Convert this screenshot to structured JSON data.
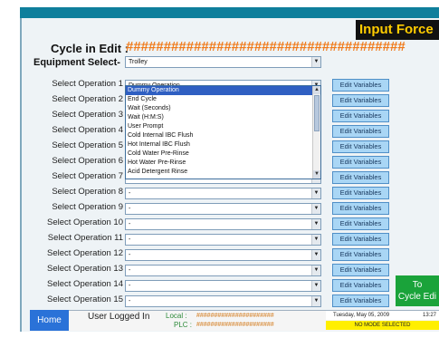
{
  "header": {
    "title": "Input Force",
    "cycle_label": "Cycle in Edit :",
    "cycle_value": "#####################################",
    "equipment_label": "Equipment Select-",
    "equipment_value": "Trolley"
  },
  "operations": [
    {
      "label": "Select Operation 1",
      "value": "Dummy Operation",
      "button": "Edit Variables"
    },
    {
      "label": "Select Operation 2",
      "value": "",
      "button": "Edit Variables"
    },
    {
      "label": "Select Operation 3",
      "value": "",
      "button": "Edit Variables"
    },
    {
      "label": "Select Operation 4",
      "value": "",
      "button": "Edit Variables"
    },
    {
      "label": "Select Operation 5",
      "value": "",
      "button": "Edit Variables"
    },
    {
      "label": "Select Operation 6",
      "value": "",
      "button": "Edit Variables"
    },
    {
      "label": "Select Operation 7",
      "value": "",
      "button": "Edit Variables"
    },
    {
      "label": "Select Operation 8",
      "value": "-",
      "button": "Edit Variables"
    },
    {
      "label": "Select Operation 9",
      "value": "-",
      "button": "Edit Variables"
    },
    {
      "label": "Select Operation 10",
      "value": "-",
      "button": "Edit Variables"
    },
    {
      "label": "Select Operation 11",
      "value": "-",
      "button": "Edit Variables"
    },
    {
      "label": "Select Operation 12",
      "value": "-",
      "button": "Edit Variables"
    },
    {
      "label": "Select Operation 13",
      "value": "-",
      "button": "Edit Variables"
    },
    {
      "label": "Select Operation 14",
      "value": "-",
      "button": "Edit Variables"
    },
    {
      "label": "Select Operation 15",
      "value": "-",
      "button": "Edit Variables"
    }
  ],
  "dropdown": {
    "items": [
      "Dummy Operation",
      "End Cycle",
      "Wait (Seconds)",
      "Wait (H:M:S)",
      "User Prompt",
      "Cold Internal IBC Flush",
      "Hot Internal IBC Flush",
      "Cold Water Pre-Rinse",
      "Hot Water Pre-Rinse",
      "Acid Detergent Rinse"
    ],
    "selected": "Dummy Operation"
  },
  "to_cycle_button": {
    "line1": "To",
    "line2": "Cycle Edi"
  },
  "footer": {
    "home": "Home",
    "user_label": "User Logged In",
    "local_label": "Local :",
    "local_value": "######################",
    "plc_label": "PLC :",
    "plc_value": "######################",
    "date": "Tuesday, May 05, 2009",
    "time": "13:27",
    "mode": "NO MODE SELECTED"
  },
  "colors": {
    "top_bar": "#0f7f9c",
    "title_text": "#ffcc00",
    "cycle_hash": "#f07a1a",
    "edit_button": "#a9d6f5",
    "dropdown_selected": "#2f5fc2",
    "to_cycle_button": "#1aa33a",
    "home_button": "#2a72d8",
    "mode_box": "#ffef00"
  },
  "icons": {
    "select_arrow": "chevron-down-icon",
    "scroll_up": "arrow-up-icon",
    "scroll_down": "arrow-down-icon"
  }
}
